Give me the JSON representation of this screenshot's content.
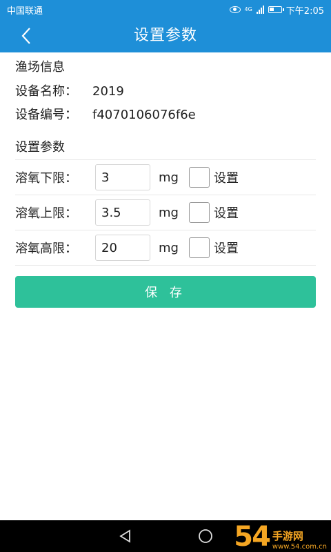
{
  "status_bar": {
    "carrier": "中国联通",
    "network": "4G",
    "time": "下午2:05"
  },
  "header": {
    "title": "设置参数"
  },
  "farm_info": {
    "section_title": "渔场信息",
    "device_name_label": "设备名称：",
    "device_name": "2019",
    "device_id_label": "设备编号：",
    "device_id": "f4070106076f6e"
  },
  "params": {
    "section_title": "设置参数",
    "rows": [
      {
        "label": "溶氧下限：",
        "value": "3",
        "unit": "mg",
        "checkbox_label": "设置"
      },
      {
        "label": "溶氧上限：",
        "value": "3.5",
        "unit": "mg",
        "checkbox_label": "设置"
      },
      {
        "label": "溶氧高限：",
        "value": "20",
        "unit": "mg",
        "checkbox_label": "设置"
      }
    ]
  },
  "save_label": "保 存",
  "watermark": {
    "logo": "54",
    "name": "手游网",
    "url": "www.54.com.cn"
  },
  "colors": {
    "primary": "#1e8fd8",
    "save_button": "#2ec19a",
    "watermark": "#f5a623"
  }
}
